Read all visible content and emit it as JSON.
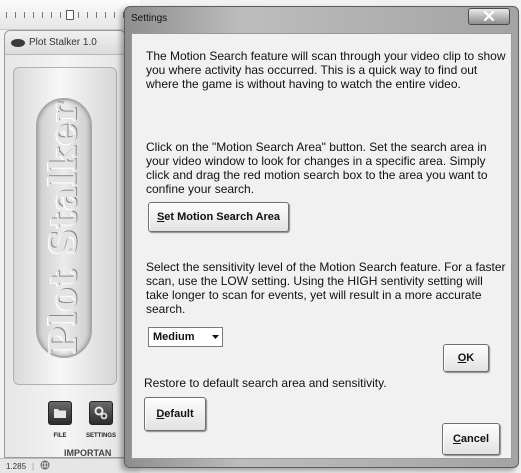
{
  "background": {
    "plot_stalker": {
      "title": "Plot Stalker 1.0",
      "logo_text": "Plot Stalker",
      "file_label": "FILE",
      "settings_label": "SETTINGS"
    },
    "status": {
      "zoom": "1.285"
    },
    "underlay_text": "IMPORTAN"
  },
  "dialog": {
    "title": "Settings",
    "intro": "The Motion Search feature will scan through your video clip to show you where activity has occurred. This is a quick way to find out where the game is without having to watch the entire video.",
    "area_instructions": "Click on the \"Motion Search Area\" button. Set the search area in your video window to look for changes in a specific area. Simply click and drag the red motion search box to the area you want to confine your search.",
    "set_area_button": {
      "mnemonic": "S",
      "rest": "et Motion Search Area"
    },
    "sensitivity_instructions": "Select the sensitivity level of the Motion Search feature. For a faster scan, use the LOW setting. Using the HIGH sentivity setting will take longer to scan for events, yet will result in a more accurate search.",
    "sensitivity_select": {
      "value": "Medium"
    },
    "ok_button": {
      "mnemonic": "O",
      "rest": "K"
    },
    "restore_text": "Restore to default search area and sensitivity.",
    "default_button": {
      "mnemonic": "D",
      "rest": "efault"
    },
    "cancel_button": {
      "mnemonic": "C",
      "rest": "ancel"
    }
  },
  "icons": {
    "app": "plot-stalker-app-icon",
    "file": "folder-icon",
    "settings": "gears-icon",
    "close": "close-x-icon",
    "dropdown": "dropdown-arrow-icon",
    "status": "globe-icon"
  },
  "colors": {
    "dialog_frame": "#a3a3a3",
    "dialog_body": "#f1f1f1",
    "close_button": "#8c8c8c"
  }
}
